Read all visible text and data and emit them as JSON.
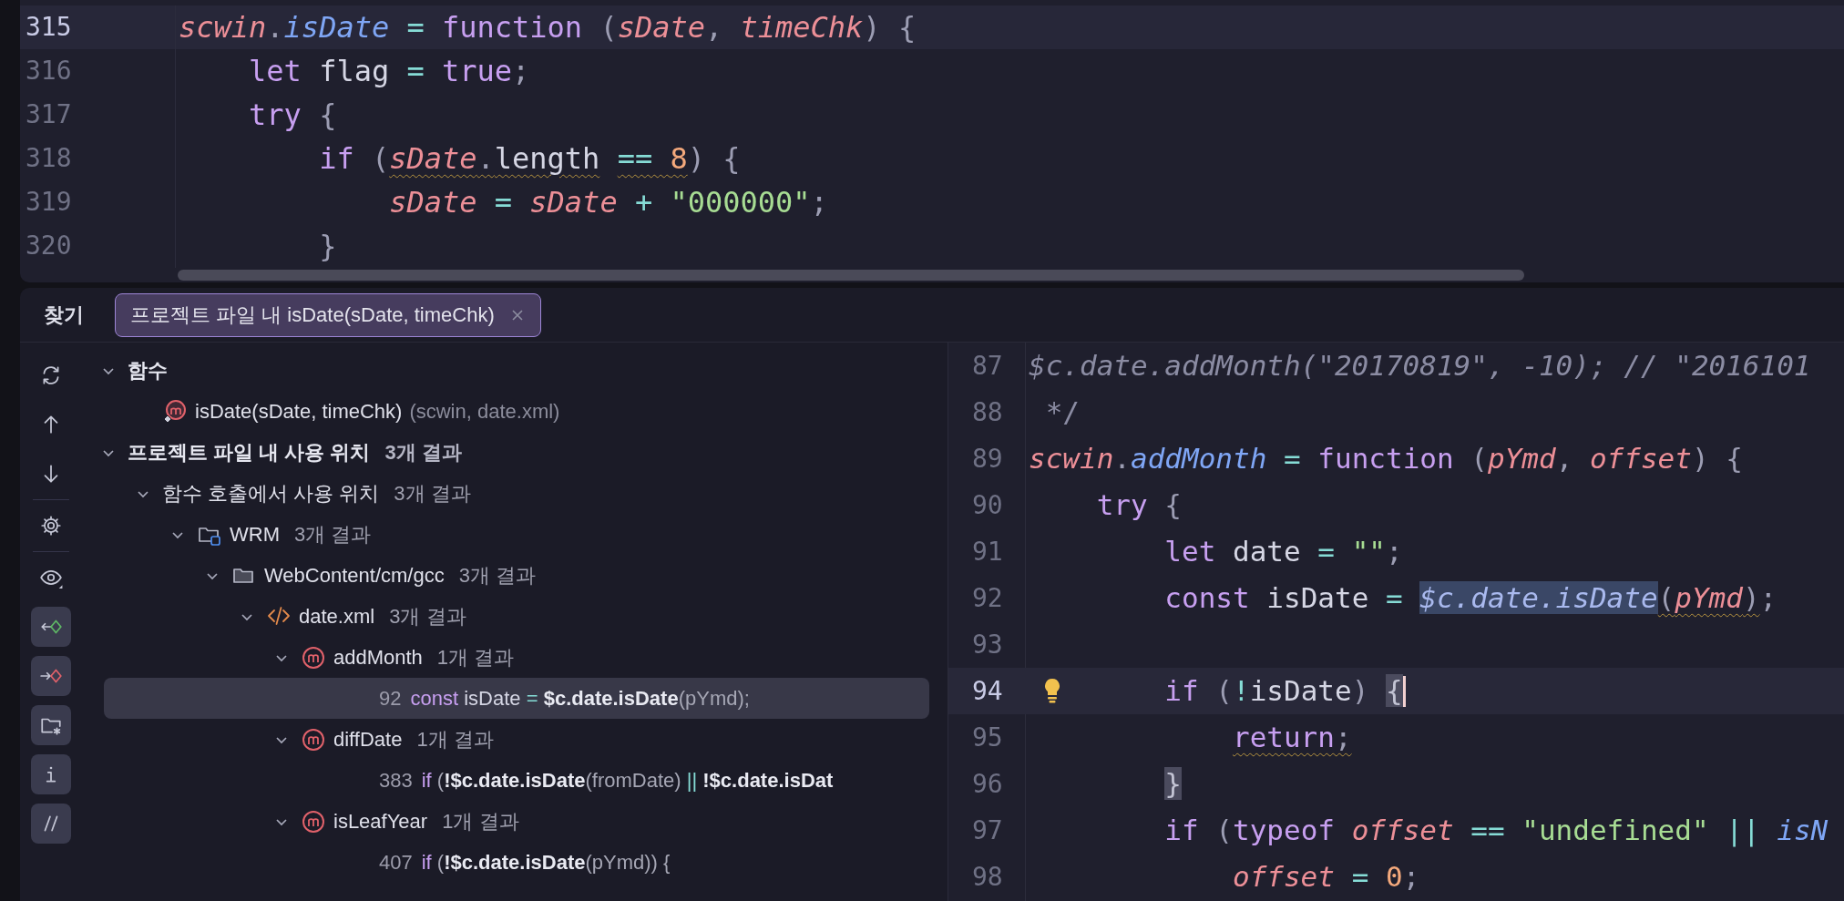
{
  "top_editor": {
    "lines": [
      {
        "number": "315",
        "current": true,
        "code": [
          {
            "t": "*scwin*",
            "color": "#ec8f97"
          },
          {
            "t": ".",
            "color": "#9c9db3"
          },
          {
            "t": "*isDate*",
            "color": "#7fa6f5"
          },
          {
            "t": " = ",
            "color": "#86dcd6"
          },
          {
            "t": "function",
            "color": "#c79ff0"
          },
          {
            "t": " (",
            "color": "#9c9db3"
          },
          {
            "t": "*sDate*",
            "color": "#ec8f97"
          },
          {
            "t": ", ",
            "color": "#9c9db3"
          },
          {
            "t": "*timeChk*",
            "color": "#ec8f97"
          },
          {
            "t": ") {",
            "color": "#9c9db3"
          }
        ]
      },
      {
        "number": "316",
        "current": false,
        "code": [
          {
            "t": "    let",
            "color": "#c79ff0"
          },
          {
            "t": " flag ",
            "color": "#d5d6e4"
          },
          {
            "t": "=",
            "color": "#86dcd6"
          },
          {
            "t": " true",
            "color": "#c79ff0"
          },
          {
            "t": ";",
            "color": "#9c9db3"
          }
        ]
      },
      {
        "number": "317",
        "current": false,
        "code": [
          {
            "t": "    try",
            "color": "#c79ff0"
          },
          {
            "t": " {",
            "color": "#9c9db3"
          }
        ]
      },
      {
        "number": "318",
        "current": false,
        "code": [
          {
            "t": "        if",
            "color": "#c79ff0"
          },
          {
            "t": " (",
            "color": "#9c9db3"
          },
          {
            "t": "*sDate*",
            "color": "#ec8f97",
            "warning": true
          },
          {
            "t": ".",
            "color": "#9c9db3",
            "warning": true
          },
          {
            "t": "length",
            "color": "#d5d6e4",
            "warning": true
          },
          {
            "t": " == ",
            "color": "#86dcd6",
            "warning": true
          },
          {
            "t": "8",
            "color": "#f4a97c",
            "warning": true
          },
          {
            "t": ") {",
            "color": "#9c9db3"
          }
        ]
      },
      {
        "number": "319",
        "current": false,
        "code": [
          {
            "t": "            *sDate*",
            "color": "#ec8f97"
          },
          {
            "t": " = ",
            "color": "#86dcd6"
          },
          {
            "t": "*sDate*",
            "color": "#ec8f97"
          },
          {
            "t": " + ",
            "color": "#86dcd6"
          },
          {
            "t": "\"000000\"",
            "color": "#a7dc93"
          },
          {
            "t": ";",
            "color": "#9c9db3"
          }
        ]
      },
      {
        "number": "320",
        "current": false,
        "code": [
          {
            "t": "        }",
            "color": "#9c9db3"
          }
        ]
      }
    ]
  },
  "find_panel": {
    "title": "찾기",
    "tabs": [
      {
        "label": "프로젝트 파일 내 isDate(sDate, timeChk)",
        "selected": true
      }
    ],
    "toolbar": [
      {
        "on": false
      },
      {
        "on": false
      },
      {
        "on": false
      },
      {
        "on": false
      },
      {
        "on": false
      },
      {
        "on": true
      },
      {
        "on": true
      },
      {
        "on": true
      },
      {
        "on": true
      },
      {
        "on": true
      }
    ],
    "tree": [
      {
        "kind": "group",
        "label": "함수",
        "expanded": true,
        "children": [
          {
            "kind": "function",
            "label": "isDate(sDate, timeChk)",
            "detail": "(scwin, date.xml)"
          }
        ]
      },
      {
        "kind": "group",
        "label": "프로젝트 파일 내 사용 위치",
        "count": "3개 결과",
        "expanded": true,
        "children": [
          {
            "kind": "category",
            "label": "함수 호출에서 사용 위치",
            "count": "3개 결과",
            "expanded": true,
            "children": [
              {
                "kind": "module",
                "label": "WRM",
                "count": "3개 결과",
                "expanded": true,
                "children": [
                  {
                    "kind": "folder",
                    "label": "WebContent/cm/gcc",
                    "count": "3개 결과",
                    "expanded": true,
                    "children": [
                      {
                        "kind": "xml",
                        "label": "date.xml",
                        "count": "3개 결과",
                        "expanded": true,
                        "children": [
                          {
                            "kind": "method",
                            "label": "addMonth",
                            "count": "1개 결과",
                            "expanded": true,
                            "children": [
                              {
                                "kind": "usage",
                                "line": "92",
                                "selected": true,
                                "code": [
                                  {
                                    "t": "const",
                                    "color": "#c79ff0"
                                  },
                                  {
                                    "t": " isDate ",
                                    "color": "#d5d6e4"
                                  },
                                  {
                                    "t": "=",
                                    "color": "#86dcd6"
                                  },
                                  {
                                    "t": " **$c.date.isDate**",
                                    "color": "#e9eaf2"
                                  },
                                  {
                                    "t": "(pYmd);",
                                    "color": "#a5a6b4"
                                  }
                                ]
                              }
                            ]
                          },
                          {
                            "kind": "method",
                            "label": "diffDate",
                            "count": "1개 결과",
                            "expanded": true,
                            "children": [
                              {
                                "kind": "usage",
                                "line": "383",
                                "selected": false,
                                "code": [
                                  {
                                    "t": "if",
                                    "color": "#c79ff0"
                                  },
                                  {
                                    "t": " (",
                                    "color": "#a5a6b4"
                                  },
                                  {
                                    "t": "**!$c.date.isDate**",
                                    "color": "#e9eaf2"
                                  },
                                  {
                                    "t": "(fromDate) ",
                                    "color": "#a5a6b4"
                                  },
                                  {
                                    "t": "||",
                                    "color": "#86dcd6"
                                  },
                                  {
                                    "t": " **!$c.date.isDat**",
                                    "color": "#e9eaf2"
                                  }
                                ]
                              }
                            ]
                          },
                          {
                            "kind": "method",
                            "label": "isLeafYear",
                            "count": "1개 결과",
                            "expanded": true,
                            "children": [
                              {
                                "kind": "usage",
                                "line": "407",
                                "selected": false,
                                "code": [
                                  {
                                    "t": "if",
                                    "color": "#c79ff0"
                                  },
                                  {
                                    "t": " (",
                                    "color": "#a5a6b4"
                                  },
                                  {
                                    "t": "**!$c.date.isDate**",
                                    "color": "#e9eaf2"
                                  },
                                  {
                                    "t": "(pYmd)) {",
                                    "color": "#a5a6b4"
                                  }
                                ]
                              }
                            ]
                          }
                        ]
                      }
                    ]
                  }
                ]
              }
            ]
          }
        ]
      }
    ],
    "preview": {
      "lines": [
        {
          "number": "87",
          "current": false,
          "bulb": false,
          "caret": false,
          "code": [
            {
              "t": "*$c.date.addMonth(\"20170819\", -10); // \"2016101*",
              "color": "#8b8ca3"
            }
          ]
        },
        {
          "number": "88",
          "current": false,
          "bulb": false,
          "caret": false,
          "code": [
            {
              "t": " */",
              "color": "#8b8ca3"
            }
          ]
        },
        {
          "number": "89",
          "current": false,
          "bulb": false,
          "caret": false,
          "code": [
            {
              "t": "*scwin*",
              "color": "#ec8f97"
            },
            {
              "t": ".",
              "color": "#9c9db3"
            },
            {
              "t": "*addMonth*",
              "color": "#7fa6f5"
            },
            {
              "t": " = ",
              "color": "#86dcd6"
            },
            {
              "t": "function",
              "color": "#c79ff0"
            },
            {
              "t": " (",
              "color": "#9c9db3"
            },
            {
              "t": "*pYmd*",
              "color": "#ec8f97"
            },
            {
              "t": ", ",
              "color": "#9c9db3"
            },
            {
              "t": "*offset*",
              "color": "#ec8f97"
            },
            {
              "t": ") {",
              "color": "#9c9db3"
            }
          ]
        },
        {
          "number": "90",
          "current": false,
          "bulb": false,
          "caret": false,
          "code": [
            {
              "t": "    try",
              "color": "#c79ff0"
            },
            {
              "t": " {",
              "color": "#9c9db3"
            }
          ]
        },
        {
          "number": "91",
          "current": false,
          "bulb": false,
          "caret": false,
          "code": [
            {
              "t": "        let",
              "color": "#c79ff0"
            },
            {
              "t": " date ",
              "color": "#d5d6e4"
            },
            {
              "t": "= ",
              "color": "#86dcd6"
            },
            {
              "t": "\"\"",
              "color": "#a7dc93"
            },
            {
              "t": ";",
              "color": "#9c9db3"
            }
          ]
        },
        {
          "number": "92",
          "current": false,
          "bulb": false,
          "caret": false,
          "code": [
            {
              "t": "        const",
              "color": "#c79ff0"
            },
            {
              "t": " isDate ",
              "color": "#d5d6e4"
            },
            {
              "t": "= ",
              "color": "#86dcd6"
            },
            {
              "t": "*$c.date.isDate*",
              "highlighted": true
            },
            {
              "t": "(",
              "color": "#9c9db3",
              "warning": true
            },
            {
              "t": "*pYmd*",
              "color": "#ec8f97",
              "warning": true
            },
            {
              "t": ")",
              "color": "#9c9db3",
              "warning": true
            },
            {
              "t": ";",
              "color": "#9c9db3"
            }
          ]
        },
        {
          "number": "93",
          "current": false,
          "bulb": false,
          "caret": false
        },
        {
          "number": "94",
          "current": true,
          "bulb": true,
          "caret": true,
          "code": [
            {
              "t": "        if",
              "color": "#c79ff0"
            },
            {
              "t": " (",
              "color": "#9c9db3"
            },
            {
              "t": "!",
              "color": "#86dcd6"
            },
            {
              "t": "isDate",
              "color": "#d5d6e4"
            },
            {
              "t": ") ",
              "color": "#9c9db3"
            },
            {
              "t": "{",
              "brace_match": true
            }
          ]
        },
        {
          "number": "95",
          "current": false,
          "bulb": false,
          "caret": false,
          "code": [
            {
              "t": "            return",
              "color": "#c79ff0",
              "warning": true
            },
            {
              "t": ";",
              "color": "#9c9db3",
              "warning": true
            }
          ]
        },
        {
          "number": "96",
          "current": false,
          "bulb": false,
          "caret": false,
          "code": [
            {
              "t": "        }",
              "brace_match": true
            }
          ]
        },
        {
          "number": "97",
          "current": false,
          "bulb": false,
          "caret": false,
          "code": [
            {
              "t": "        if",
              "color": "#c79ff0"
            },
            {
              "t": " (",
              "color": "#9c9db3"
            },
            {
              "t": "typeof",
              "color": "#c79ff0"
            },
            {
              "t": " *offset*",
              "color": "#ec8f97"
            },
            {
              "t": " == ",
              "color": "#86dcd6"
            },
            {
              "t": "\"undefined\"",
              "color": "#a7dc93"
            },
            {
              "t": " || ",
              "color": "#86dcd6"
            },
            {
              "t": "*isN*",
              "color": "#7fa6f5"
            }
          ]
        },
        {
          "number": "98",
          "current": false,
          "bulb": false,
          "caret": false,
          "code": [
            {
              "t": "            *offset*",
              "color": "#ec8f97"
            },
            {
              "t": " = ",
              "color": "#86dcd6"
            },
            {
              "t": "0",
              "color": "#f4a97c"
            },
            {
              "t": ";",
              "color": "#9c9db3"
            }
          ]
        }
      ]
    }
  }
}
